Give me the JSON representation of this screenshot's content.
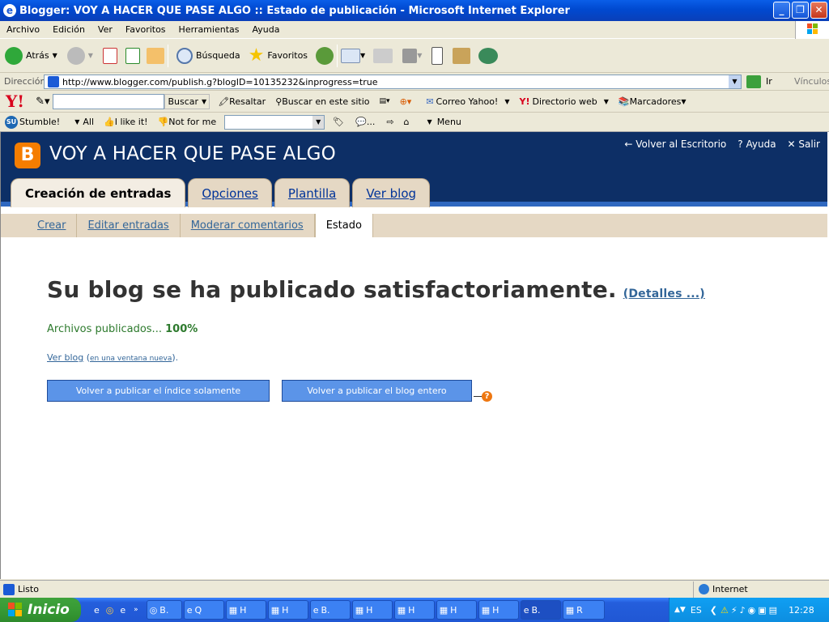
{
  "window": {
    "title": "Blogger: VOY A HACER QUE PASE ALGO :: Estado de publicación - Microsoft Internet Explorer"
  },
  "menu": [
    "Archivo",
    "Edición",
    "Ver",
    "Favoritos",
    "Herramientas",
    "Ayuda"
  ],
  "toolbar": {
    "back": "Atrás",
    "search": "Búsqueda",
    "favorites": "Favoritos"
  },
  "address": {
    "label": "Dirección",
    "url": "http://www.blogger.com/publish.g?blogID=10135232&inprogress=true",
    "go": "Ir",
    "links": "Vínculos"
  },
  "yahoo": {
    "search_btn": "Buscar",
    "highlight": "Resaltar",
    "site_search": "Buscar en este sitio",
    "mail": "Correo Yahoo!",
    "directory": "Directorio web",
    "bookmarks": "Marcadores"
  },
  "stumble": {
    "stumble": "Stumble!",
    "all": "All",
    "like": "I like it!",
    "notfor": "Not for me",
    "menu": "Menu",
    "comment": "..."
  },
  "blog": {
    "title": "VOY A HACER QUE PASE ALGO",
    "top_links": [
      "Volver al Escritorio",
      "Ayuda",
      "Salir"
    ],
    "tabs": [
      "Creación de entradas",
      "Opciones",
      "Plantilla",
      "Ver blog"
    ],
    "subnav": [
      "Crear",
      "Editar entradas",
      "Moderar comentarios",
      "Estado"
    ],
    "message": "Su blog se ha publicado satisfactoriamente.",
    "details": "(Detalles ...)",
    "files_label": "Archivos publicados...",
    "files_value": "100%",
    "view_blog": "Ver blog",
    "new_window": "en una ventana nueva",
    "btn_index": "Volver a publicar el índice solamente",
    "btn_all": "Volver a publicar el blog entero"
  },
  "status": {
    "text": "Listo",
    "zone": "Internet"
  },
  "taskbar": {
    "start": "Inicio",
    "tasks": [
      "B.",
      "Q",
      "H",
      "H",
      "B.",
      "H",
      "H",
      "H",
      "H",
      "B.",
      "R"
    ],
    "lang": "ES",
    "time": "12:28"
  }
}
